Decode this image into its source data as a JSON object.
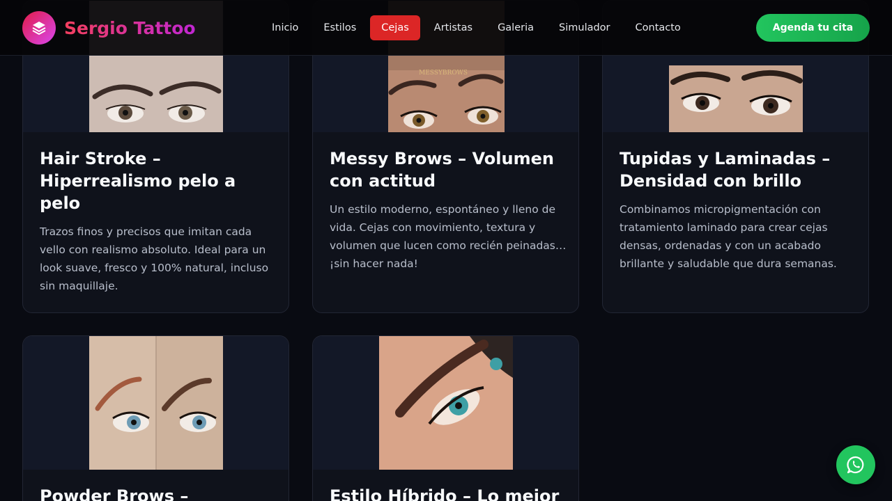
{
  "brand": {
    "name": "Sergio Tattoo",
    "icon": "layers-icon"
  },
  "nav": {
    "items": [
      {
        "label": "Inicio"
      },
      {
        "label": "Estilos"
      },
      {
        "label": "Cejas",
        "active": true
      },
      {
        "label": "Artistas"
      },
      {
        "label": "Galeria"
      },
      {
        "label": "Simulador"
      },
      {
        "label": "Contacto"
      }
    ],
    "cta_label": "Agenda tu cita"
  },
  "cards": [
    {
      "title": "Hair Stroke – Hiperrealismo pelo a pelo",
      "description": "Trazos finos y precisos que imitan cada vello con realismo absoluto. Ideal para un look suave, fresco y 100% natural, incluso sin maquillaje."
    },
    {
      "title": "Messy Brows – Volumen con actitud",
      "description": "Un estilo moderno, espontáneo y lleno de vida. Cejas con movimiento, textura y volumen que lucen como recién peinadas… ¡sin hacer nada!",
      "image_caption": "MESSYBROWS"
    },
    {
      "title": "Tupidas y Laminadas – Densidad con brillo",
      "description": "Combinamos micropigmentación con tratamiento laminado para crear cejas densas, ordenadas y con un acabado brillante y saludable que dura semanas."
    },
    {
      "title": "Powder Brows –",
      "description": ""
    },
    {
      "title": "Estilo Híbrido – Lo mejor",
      "description": ""
    }
  ],
  "colors": {
    "accent": "#dc2626",
    "cta": "#22c55e",
    "brand_gradient_start": "#f43f5e",
    "brand_gradient_end": "#c026d3",
    "background": "#090b12",
    "card": "#0f121b"
  },
  "whatsapp": {
    "icon": "whatsapp-icon"
  }
}
